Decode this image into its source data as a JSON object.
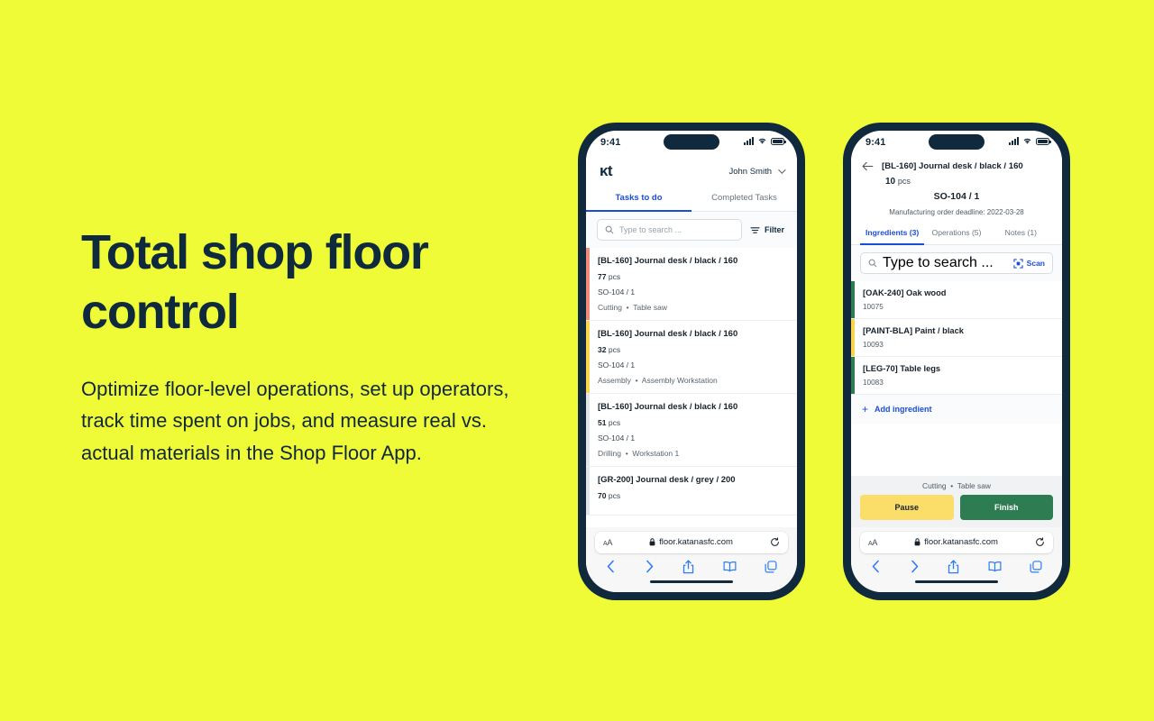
{
  "marketing": {
    "headline": "Total shop floor control",
    "body": "Optimize floor-level operations, set up operators, track time spent on jobs, and measure real vs. actual materials in the Shop Floor App."
  },
  "colors": {
    "background": "#EEFB36",
    "ink": "#11293C",
    "accent_blue": "#1B4ED8",
    "pause_yellow": "#FBDE6A",
    "finish_green": "#2E7D52",
    "bar_red": "#F08B7A",
    "bar_yellow": "#FBD44E",
    "bar_grey": "#E2E5E8",
    "bar_green": "#2E7D52"
  },
  "status_bar": {
    "time": "9:41",
    "cellular_icon": "cellular-signal-icon",
    "wifi_icon": "wifi-icon",
    "battery_icon": "battery-icon"
  },
  "safari": {
    "aa_label": "AA",
    "lock_icon": "lock-icon",
    "url": "floor.katanasfc.com",
    "reload_icon": "reload-icon",
    "back_icon": "chevron-left-icon",
    "forward_icon": "chevron-right-icon",
    "share_icon": "share-icon",
    "bookmarks_icon": "book-icon",
    "tabs_icon": "tabs-icon"
  },
  "phone_left": {
    "header": {
      "logo": "κt",
      "user": "John Smith",
      "chevron_icon": "chevron-down-icon"
    },
    "tabs": [
      {
        "label": "Tasks to do",
        "active": true
      },
      {
        "label": "Completed Tasks",
        "active": false
      }
    ],
    "search": {
      "placeholder": "Type to search ...",
      "icon": "search-icon"
    },
    "filter": {
      "label": "Filter",
      "icon": "filter-icon"
    },
    "tasks": [
      {
        "title": "[BL-160] Journal desk / black / 160",
        "qty": "77",
        "unit": "pcs",
        "order": "SO-104 / 1",
        "operation": "Cutting",
        "workstation": "Table saw",
        "bar_color": "#F08B7A"
      },
      {
        "title": "[BL-160] Journal desk / black / 160",
        "qty": "32",
        "unit": "pcs",
        "order": "SO-104 / 1",
        "operation": "Assembly",
        "workstation": "Assembly Workstation",
        "bar_color": "#FBD44E"
      },
      {
        "title": "[BL-160] Journal desk / black / 160",
        "qty": "51",
        "unit": "pcs",
        "order": "SO-104 / 1",
        "operation": "Drilling",
        "workstation": "Workstation 1",
        "bar_color": "#E2E5E8"
      },
      {
        "title": "[GR-200] Journal desk / grey / 200",
        "qty": "70",
        "unit": "pcs",
        "order": "",
        "operation": "",
        "workstation": "",
        "bar_color": "#E2E5E8"
      }
    ]
  },
  "phone_right": {
    "header": {
      "back_icon": "arrow-left-icon",
      "title": "[BL-160] Journal desk / black / 160",
      "qty": "10",
      "unit": "pcs",
      "sales_order": "SO-104 / 1",
      "deadline": "Manufacturing order deadline: 2022-03-28"
    },
    "tabs": [
      {
        "label": "Ingredients (3)",
        "active": true
      },
      {
        "label": "Operations (5)",
        "active": false
      },
      {
        "label": "Notes (1)",
        "active": false
      }
    ],
    "search": {
      "placeholder": "Type to search ...",
      "icon": "search-icon"
    },
    "scan": {
      "label": "Scan",
      "icon": "scan-icon"
    },
    "ingredients": [
      {
        "title": "[OAK-240] Oak wood",
        "code": "10075",
        "bar_color": "#2E7D52"
      },
      {
        "title": "[PAINT-BLA] Paint / black",
        "code": "10093",
        "bar_color": "#FBD44E"
      },
      {
        "title": "[LEG-70] Table legs",
        "code": "10083",
        "bar_color": "#2E7D52"
      }
    ],
    "add_ingredient": {
      "label": "Add ingredient",
      "icon": "plus-icon"
    },
    "footer": {
      "operation": "Cutting",
      "workstation": "Table saw",
      "pause_label": "Pause",
      "finish_label": "Finish"
    }
  }
}
